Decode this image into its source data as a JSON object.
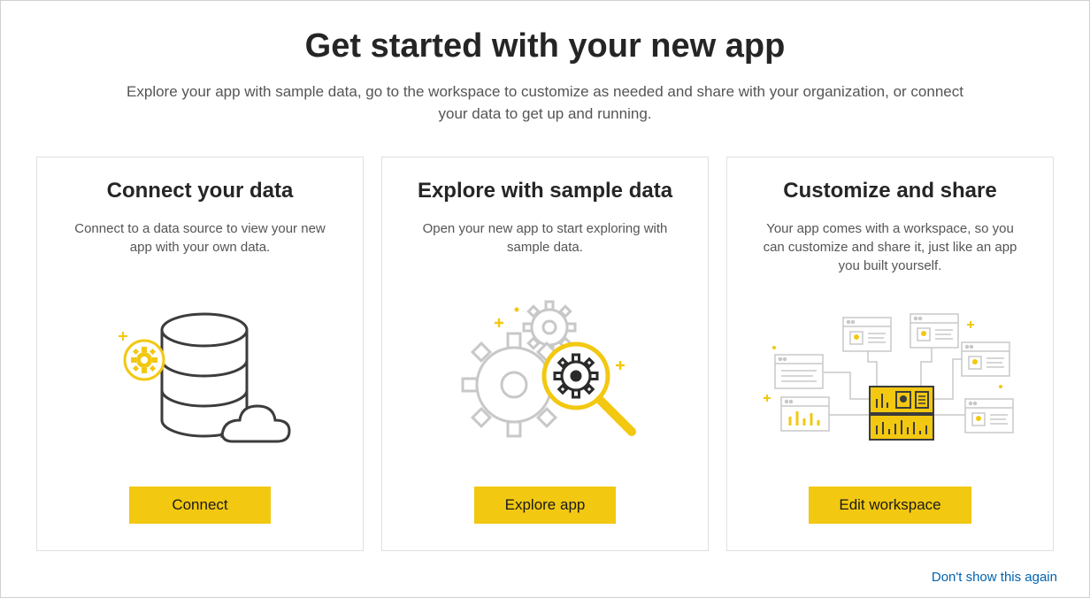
{
  "header": {
    "title": "Get started with your new app",
    "subtitle": "Explore your app with sample data, go to the workspace to customize as needed and share with your organization, or connect your data to get up and running."
  },
  "cards": [
    {
      "title": "Connect your data",
      "description": "Connect to a data source to view your new app with your own data.",
      "button": "Connect"
    },
    {
      "title": "Explore with sample data",
      "description": "Open your new app to start exploring with sample data.",
      "button": "Explore app"
    },
    {
      "title": "Customize and share",
      "description": "Your app comes with a workspace, so you can customize and share it, just like an app you built yourself.",
      "button": "Edit workspace"
    }
  ],
  "footer": {
    "dont_show": "Don't show this again"
  }
}
